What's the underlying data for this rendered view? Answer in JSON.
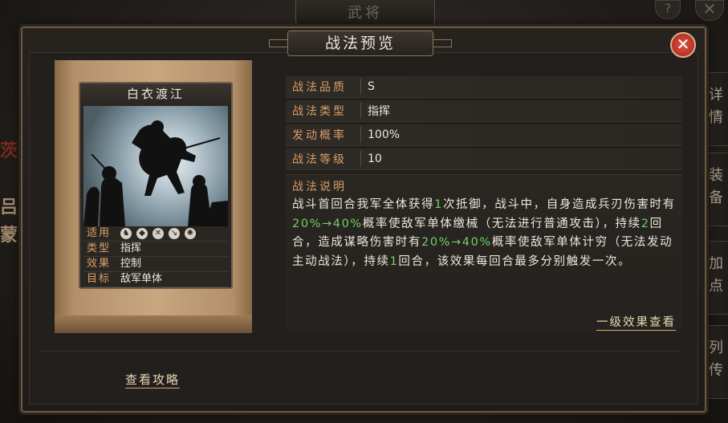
{
  "background": {
    "title": "武将",
    "help_glyph": "?",
    "close_glyph": "✕",
    "side_tabs": [
      "详情",
      "装备",
      "加点",
      "列传"
    ],
    "left_chars": [
      "茨",
      "吕",
      "蒙"
    ]
  },
  "dialog": {
    "title": "战法预览",
    "close_glyph": "✕"
  },
  "card": {
    "name": "白衣渡江",
    "rows": [
      {
        "label": "适用",
        "icons": [
          "cavalry-icon",
          "shield-icon",
          "bow-icon",
          "spear-icon",
          "siege-icon"
        ]
      },
      {
        "label": "类型",
        "value": "指挥"
      },
      {
        "label": "效果",
        "value": "控制"
      },
      {
        "label": "目标",
        "value": "敌军单体"
      }
    ]
  },
  "info": [
    {
      "label": "战法品质",
      "value": "S"
    },
    {
      "label": "战法类型",
      "value": "指挥"
    },
    {
      "label": "发动概率",
      "value": "100%"
    },
    {
      "label": "战法等级",
      "value": "10"
    }
  ],
  "description": {
    "title": "战法说明",
    "segments": [
      {
        "t": "战斗首回合我军全体获得",
        "hl": false
      },
      {
        "t": "1",
        "hl": true
      },
      {
        "t": "次抵御，战斗中，自身造成兵刃伤害时有",
        "hl": false
      },
      {
        "t": "20%→40%",
        "hl": true
      },
      {
        "t": "概率使敌军单体缴械（无法进行普通攻击），持续",
        "hl": false
      },
      {
        "t": "2",
        "hl": true
      },
      {
        "t": "回合，造成谋略伤害时有",
        "hl": false
      },
      {
        "t": "20%→40%",
        "hl": true
      },
      {
        "t": "概率使敌军单体计穷（无法发动主动战法），持续",
        "hl": false
      },
      {
        "t": "1",
        "hl": true
      },
      {
        "t": "回合，该效果每回合最多分别触发一次。",
        "hl": false
      }
    ],
    "link": "一级效果查看"
  },
  "guide_link": "查看攻略",
  "colors": {
    "label": "#d99e66",
    "highlight": "#6fd06a",
    "close_red": "#c8372a"
  }
}
